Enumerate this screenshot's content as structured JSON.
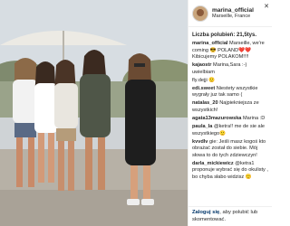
{
  "post": {
    "username": "marina_official",
    "location": "Marseille, France",
    "likes_label": "Liczba polubień: 21,5tys.",
    "close_icon": "close-icon"
  },
  "comments": [
    {
      "user": "marina_official",
      "text": "Marseille, we're coming 😎 POLAND❤️❤️ Kibicujemy POLAKOM!!!!"
    },
    {
      "user": "kajaostr",
      "text": "Marina,Sara :-) uwielbiam"
    },
    {
      "user": "",
      "text": "fly.dejji 🙂"
    },
    {
      "user": "edi.sweet",
      "text": "Niestety wszystkie wygrały juz tak samo ("
    },
    {
      "user": "natalas_20",
      "text": "Najpiekniejsza ze wszystkich!"
    },
    {
      "user": "agata13mazurowska",
      "text": "Marina :D"
    },
    {
      "user": "paula_la",
      "text": "@ketra!! me de sie ale wszystkiego🙂"
    },
    {
      "user": "kvvdlv",
      "text": "gie: Jeśli masz kogoś kto obrażać został do siebie. Mój słowa to do tych zdziewczyn!"
    },
    {
      "user": "darla_mickiewicz",
      "text": "@ketra1 proponuje wybrać się do okulisty , bo chyba słabo widzisz 🙂"
    }
  ],
  "footer": {
    "login_label": "Zaloguj się",
    "rest_label": ", aby polubić lub skomentować."
  }
}
